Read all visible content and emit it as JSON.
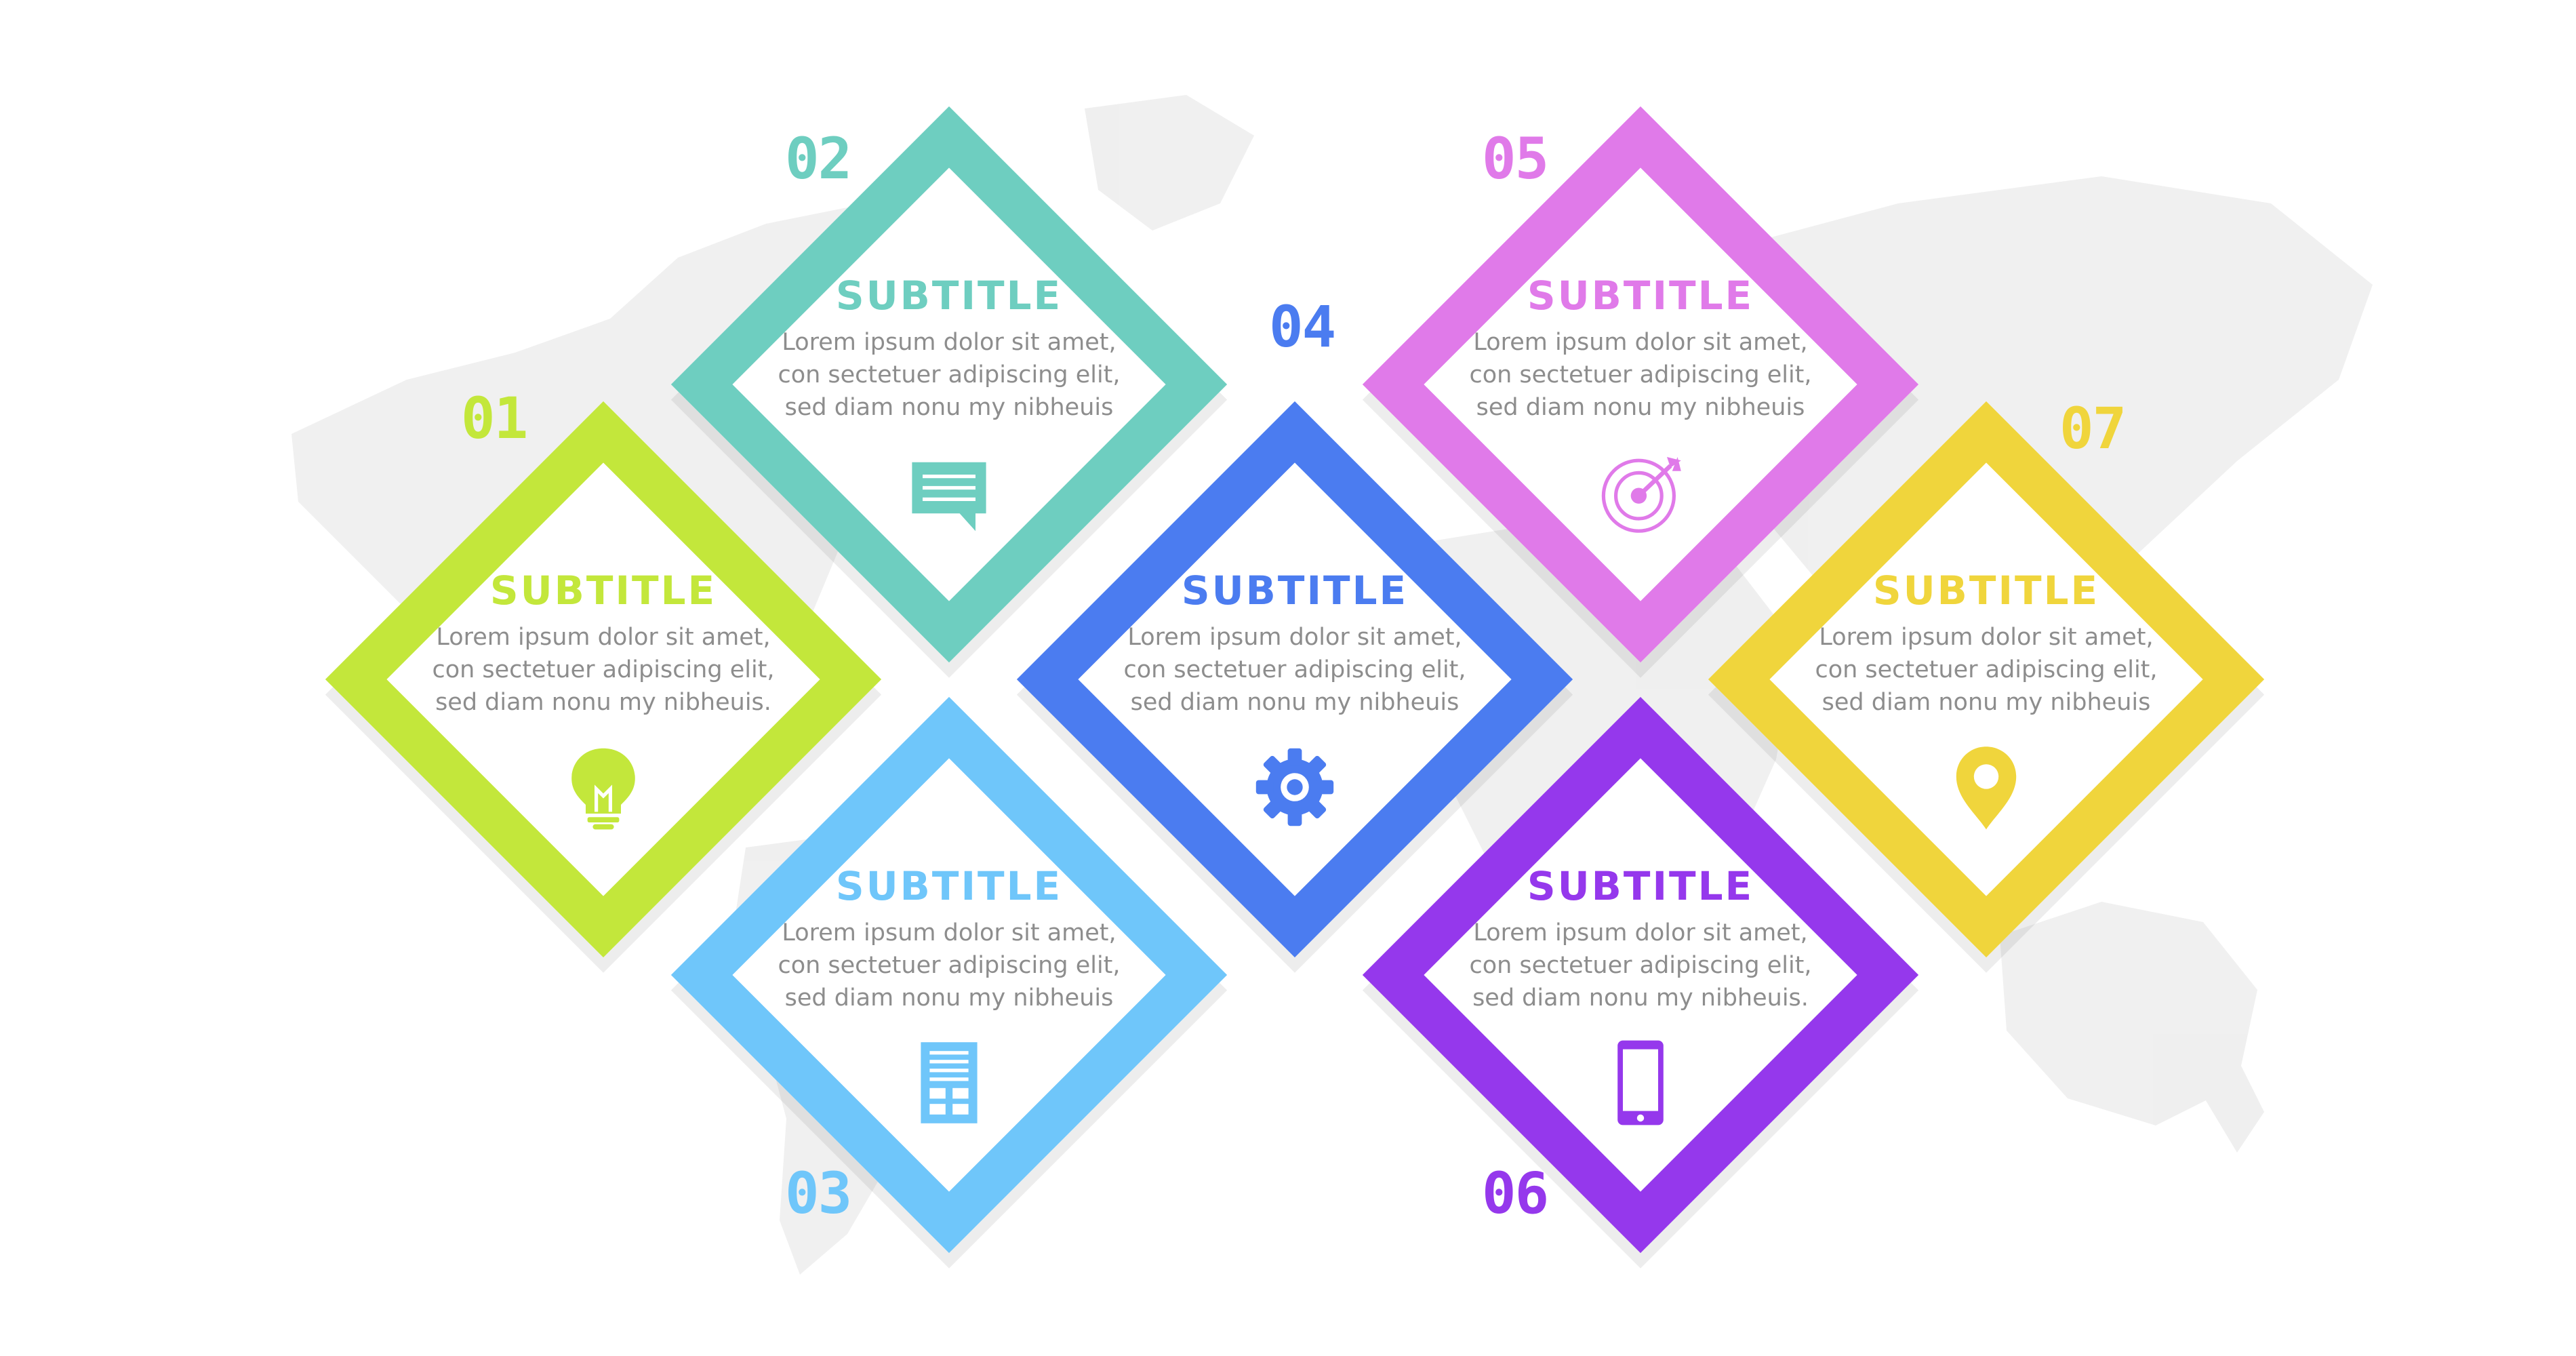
{
  "steps": [
    {
      "number": "01",
      "subtitle": "SUBTITLE",
      "text": [
        "Lorem ipsum dolor sit amet,",
        "con sectetuer adipiscing elit,",
        "sed diam nonu my nibheuis."
      ],
      "color": "#c3e73b",
      "icon": "lightbulb-icon"
    },
    {
      "number": "02",
      "subtitle": "SUBTITLE",
      "text": [
        "Lorem ipsum dolor sit amet,",
        "con sectetuer adipiscing elit,",
        "sed diam nonu my nibheuis"
      ],
      "color": "#6ecec0",
      "icon": "chat-bubble-icon"
    },
    {
      "number": "03",
      "subtitle": "SUBTITLE",
      "text": [
        "Lorem ipsum dolor sit amet,",
        "con sectetuer adipiscing elit,",
        "sed diam nonu my nibheuis"
      ],
      "color": "#6fc6fa",
      "icon": "document-icon"
    },
    {
      "number": "04",
      "subtitle": "SUBTITLE",
      "text": [
        "Lorem ipsum dolor sit amet,",
        "con sectetuer adipiscing elit,",
        "sed diam nonu my nibheuis"
      ],
      "color": "#4b7cf0",
      "icon": "gear-icon"
    },
    {
      "number": "05",
      "subtitle": "SUBTITLE",
      "text": [
        "Lorem ipsum dolor sit amet,",
        "con sectetuer adipiscing elit,",
        "sed diam nonu my nibheuis"
      ],
      "color": "#e07ae9",
      "icon": "target-dart-icon"
    },
    {
      "number": "06",
      "subtitle": "SUBTITLE",
      "text": [
        "Lorem ipsum dolor sit amet,",
        "con sectetuer adipiscing elit,",
        "sed diam nonu my nibheuis."
      ],
      "color": "#9538ec",
      "icon": "tablet-icon"
    },
    {
      "number": "07",
      "subtitle": "SUBTITLE",
      "text": [
        "Lorem ipsum dolor sit amet,",
        "con sectetuer adipiscing elit,",
        "sed diam nonu my nibheuis"
      ],
      "color": "#f0d53c",
      "icon": "map-pin-icon"
    }
  ],
  "colors": {
    "background": "#ffffff",
    "body_text": "#8d8d8d",
    "map": "#ececec"
  }
}
